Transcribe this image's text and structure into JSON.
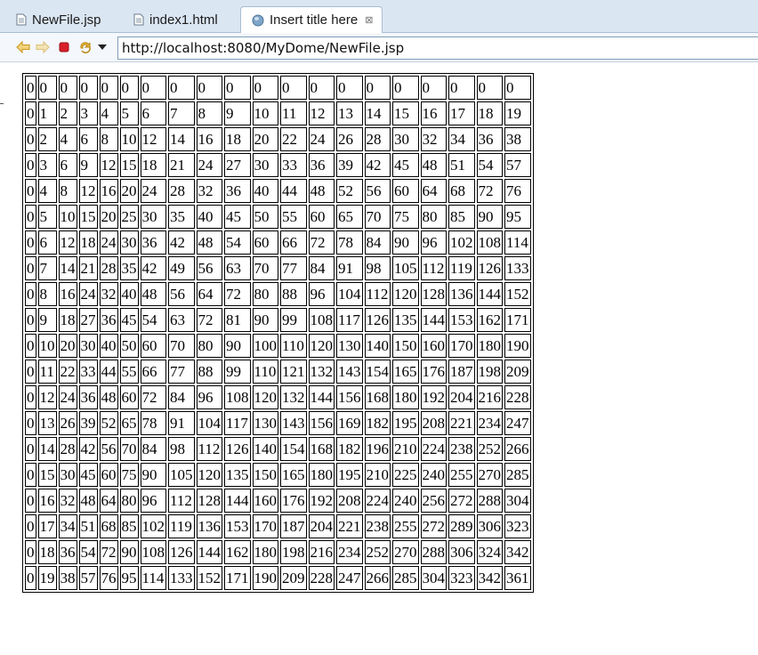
{
  "tabs": [
    {
      "label": "NewFile.jsp",
      "icon": "file-icon",
      "active": false
    },
    {
      "label": "index1.html",
      "icon": "file-icon",
      "active": false
    },
    {
      "label": "Insert title here",
      "icon": "globe-icon",
      "active": true,
      "close": "⊠"
    }
  ],
  "toolbar": {
    "back_icon": "back-arrow-icon",
    "forward_icon": "forward-arrow-icon",
    "stop_icon": "stop-icon",
    "refresh_icon": "refresh-icon",
    "dropdown_icon": "chevron-down-icon",
    "url": "http://localhost:8080/MyDome/NewFile.jsp"
  },
  "table": {
    "rows": [
      [
        "0",
        "0",
        "0",
        "0",
        "0",
        "0",
        "0",
        "0",
        "0",
        "0",
        "0",
        "0",
        "0",
        "0",
        "0",
        "0",
        "0",
        "0",
        "0",
        "0"
      ],
      [
        "0",
        "1",
        "2",
        "3",
        "4",
        "5",
        "6",
        "7",
        "8",
        "9",
        "10",
        "11",
        "12",
        "13",
        "14",
        "15",
        "16",
        "17",
        "18",
        "19"
      ],
      [
        "0",
        "2",
        "4",
        "6",
        "8",
        "10",
        "12",
        "14",
        "16",
        "18",
        "20",
        "22",
        "24",
        "26",
        "28",
        "30",
        "32",
        "34",
        "36",
        "38"
      ],
      [
        "0",
        "3",
        "6",
        "9",
        "12",
        "15",
        "18",
        "21",
        "24",
        "27",
        "30",
        "33",
        "36",
        "39",
        "42",
        "45",
        "48",
        "51",
        "54",
        "57"
      ],
      [
        "0",
        "4",
        "8",
        "12",
        "16",
        "20",
        "24",
        "28",
        "32",
        "36",
        "40",
        "44",
        "48",
        "52",
        "56",
        "60",
        "64",
        "68",
        "72",
        "76"
      ],
      [
        "0",
        "5",
        "10",
        "15",
        "20",
        "25",
        "30",
        "35",
        "40",
        "45",
        "50",
        "55",
        "60",
        "65",
        "70",
        "75",
        "80",
        "85",
        "90",
        "95"
      ],
      [
        "0",
        "6",
        "12",
        "18",
        "24",
        "30",
        "36",
        "42",
        "48",
        "54",
        "60",
        "66",
        "72",
        "78",
        "84",
        "90",
        "96",
        "102",
        "108",
        "114"
      ],
      [
        "0",
        "7",
        "14",
        "21",
        "28",
        "35",
        "42",
        "49",
        "56",
        "63",
        "70",
        "77",
        "84",
        "91",
        "98",
        "105",
        "112",
        "119",
        "126",
        "133"
      ],
      [
        "0",
        "8",
        "16",
        "24",
        "32",
        "40",
        "48",
        "56",
        "64",
        "72",
        "80",
        "88",
        "96",
        "104",
        "112",
        "120",
        "128",
        "136",
        "144",
        "152"
      ],
      [
        "0",
        "9",
        "18",
        "27",
        "36",
        "45",
        "54",
        "63",
        "72",
        "81",
        "90",
        "99",
        "108",
        "117",
        "126",
        "135",
        "144",
        "153",
        "162",
        "171"
      ],
      [
        "0",
        "10",
        "20",
        "30",
        "40",
        "50",
        "60",
        "70",
        "80",
        "90",
        "100",
        "110",
        "120",
        "130",
        "140",
        "150",
        "160",
        "170",
        "180",
        "190"
      ],
      [
        "0",
        "11",
        "22",
        "33",
        "44",
        "55",
        "66",
        "77",
        "88",
        "99",
        "110",
        "121",
        "132",
        "143",
        "154",
        "165",
        "176",
        "187",
        "198",
        "209"
      ],
      [
        "0",
        "12",
        "24",
        "36",
        "48",
        "60",
        "72",
        "84",
        "96",
        "108",
        "120",
        "132",
        "144",
        "156",
        "168",
        "180",
        "192",
        "204",
        "216",
        "228"
      ],
      [
        "0",
        "13",
        "26",
        "39",
        "52",
        "65",
        "78",
        "91",
        "104",
        "117",
        "130",
        "143",
        "156",
        "169",
        "182",
        "195",
        "208",
        "221",
        "234",
        "247"
      ],
      [
        "0",
        "14",
        "28",
        "42",
        "56",
        "70",
        "84",
        "98",
        "112",
        "126",
        "140",
        "154",
        "168",
        "182",
        "196",
        "210",
        "224",
        "238",
        "252",
        "266"
      ],
      [
        "0",
        "15",
        "30",
        "45",
        "60",
        "75",
        "90",
        "105",
        "120",
        "135",
        "150",
        "165",
        "180",
        "195",
        "210",
        "225",
        "240",
        "255",
        "270",
        "285"
      ],
      [
        "0",
        "16",
        "32",
        "48",
        "64",
        "80",
        "96",
        "112",
        "128",
        "144",
        "160",
        "176",
        "192",
        "208",
        "224",
        "240",
        "256",
        "272",
        "288",
        "304"
      ],
      [
        "0",
        "17",
        "34",
        "51",
        "68",
        "85",
        "102",
        "119",
        "136",
        "153",
        "170",
        "187",
        "204",
        "221",
        "238",
        "255",
        "272",
        "289",
        "306",
        "323"
      ],
      [
        "0",
        "18",
        "36",
        "54",
        "72",
        "90",
        "108",
        "126",
        "144",
        "162",
        "180",
        "198",
        "216",
        "234",
        "252",
        "270",
        "288",
        "306",
        "324",
        "342"
      ],
      [
        "0",
        "19",
        "38",
        "57",
        "76",
        "95",
        "114",
        "133",
        "152",
        "171",
        "190",
        "209",
        "228",
        "247",
        "266",
        "285",
        "304",
        "323",
        "342",
        "361"
      ]
    ]
  },
  "colors": {
    "tabbar_bg": "#dbe6f3",
    "back_forward": "#e2b33c",
    "stop": "#d9202a",
    "refresh": "#d9a520"
  }
}
